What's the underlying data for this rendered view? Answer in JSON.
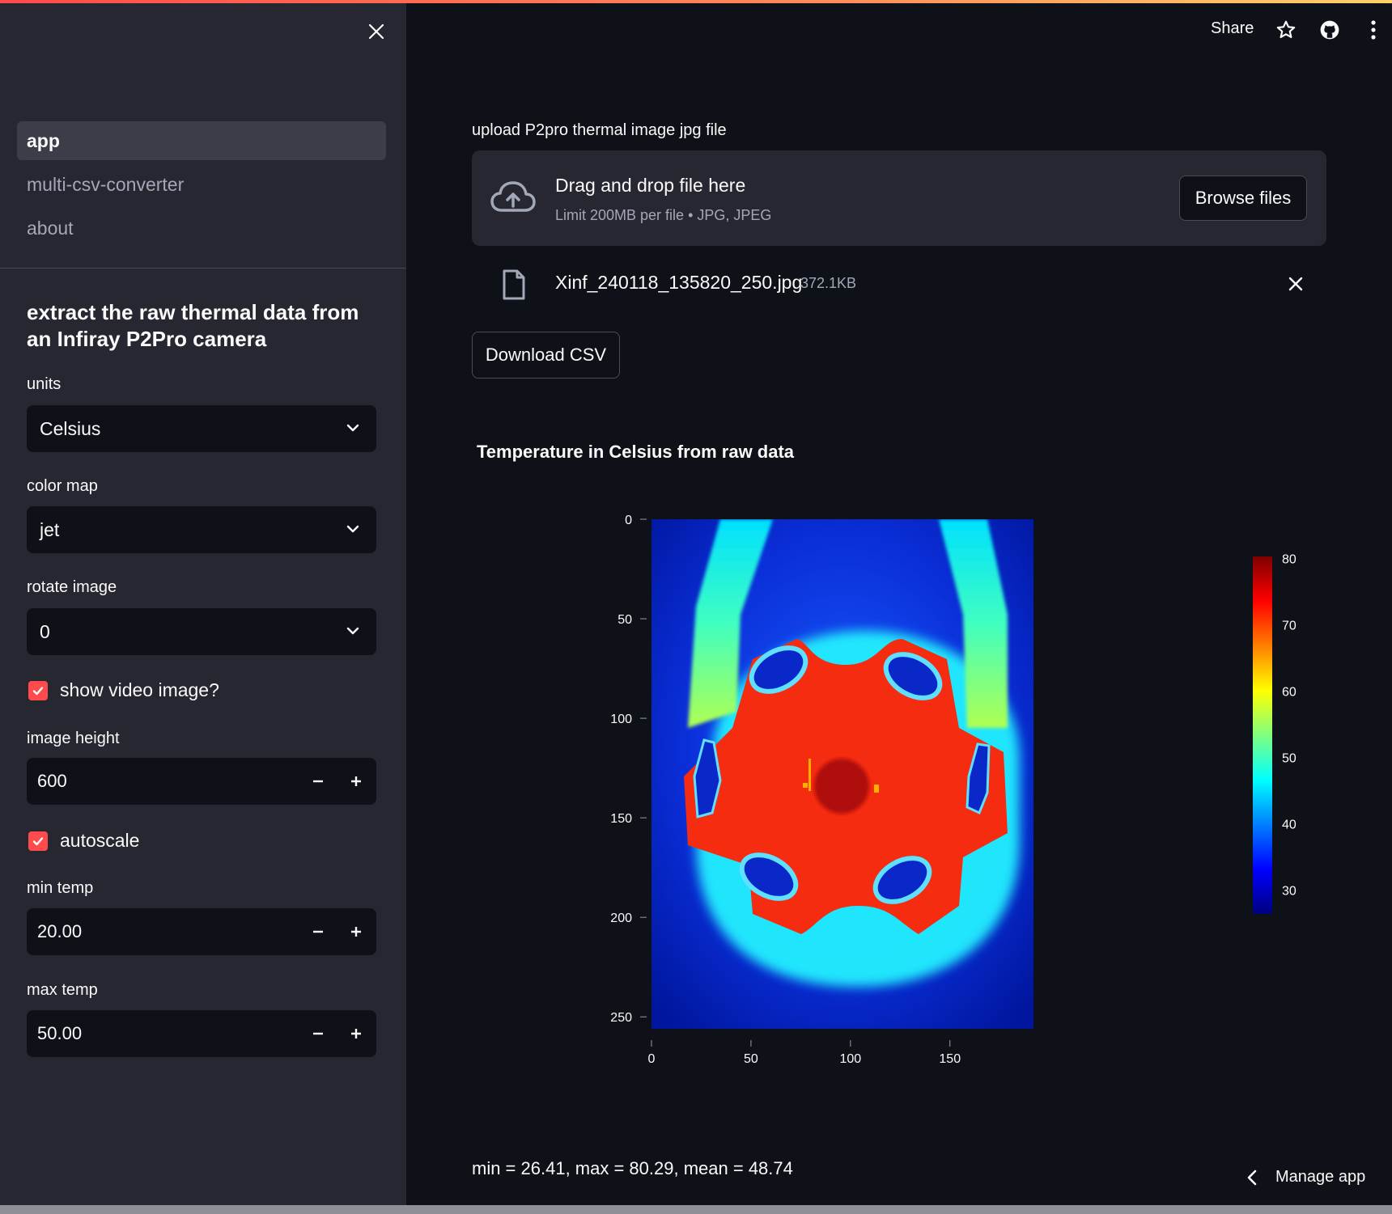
{
  "sidebar": {
    "nav": [
      {
        "label": "app",
        "active": true
      },
      {
        "label": "multi-csv-converter",
        "active": false
      },
      {
        "label": "about",
        "active": false
      }
    ],
    "title": "extract the raw thermal data from an Infiray P2Pro camera",
    "units": {
      "label": "units",
      "value": "Celsius"
    },
    "color_map": {
      "label": "color map",
      "value": "jet"
    },
    "rotate": {
      "label": "rotate image",
      "value": "0"
    },
    "show_video": {
      "label": "show video image?",
      "checked": true
    },
    "image_height": {
      "label": "image height",
      "value": "600"
    },
    "autoscale": {
      "label": "autoscale",
      "checked": true
    },
    "min_temp": {
      "label": "min temp",
      "value": "20.00"
    },
    "max_temp": {
      "label": "max temp",
      "value": "50.00"
    }
  },
  "header": {
    "share_label": "Share",
    "icons": [
      "star-icon",
      "github-icon",
      "more-vertical-icon"
    ]
  },
  "uploader": {
    "label": "upload P2pro thermal image jpg file",
    "drop_text": "Drag and drop file here",
    "limit_text": "Limit 200MB per file • JPG, JPEG",
    "browse_label": "Browse files",
    "file_name": "Xinf_240118_135820_250.jpg",
    "file_size": "372.1KB"
  },
  "download_label": "Download CSV",
  "plot": {
    "title": "Temperature in Celsius from raw data",
    "colorscale": "jet"
  },
  "chart_data": {
    "type": "heatmap",
    "title": "Temperature in Celsius from raw data",
    "xlabel": "",
    "ylabel": "",
    "xlim": [
      0,
      192
    ],
    "ylim": [
      256,
      0
    ],
    "x_ticks": [
      "0",
      "50",
      "100",
      "150"
    ],
    "y_ticks": [
      "0",
      "50",
      "100",
      "150",
      "200",
      "250"
    ],
    "colorbar": {
      "ticks": [
        "30",
        "40",
        "50",
        "60",
        "70",
        "80"
      ],
      "range": [
        26.41,
        80.29
      ]
    },
    "z_summary": {
      "min": 26.41,
      "max": 80.29,
      "mean": 48.74
    }
  },
  "stats_text": "min = 26.41, max = 80.29, mean = 48.74",
  "manage_label": "Manage app"
}
